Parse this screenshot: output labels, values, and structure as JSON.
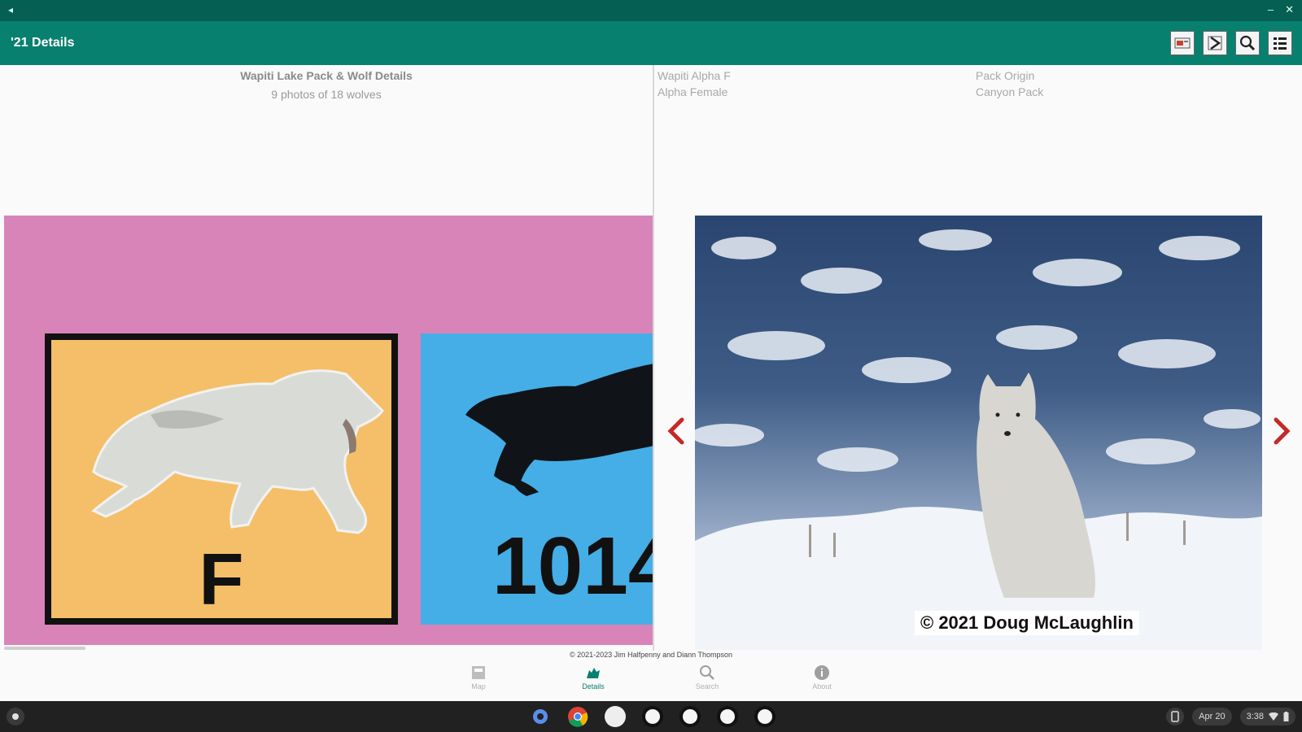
{
  "window": {
    "left_glyph": "◂",
    "min_glyph": "–",
    "close_glyph": "✕"
  },
  "appbar": {
    "title": "'21 Details",
    "actions": [
      {
        "icon": "map-view-icon"
      },
      {
        "icon": "expand-icon"
      },
      {
        "icon": "zoom-icon"
      },
      {
        "icon": "list-icon"
      }
    ]
  },
  "pack": {
    "title": "Wapiti Lake Pack & Wolf Details",
    "subtitle": "9 photos of 18 wolves",
    "card_letter": "F",
    "card_number": "1014"
  },
  "wolf": {
    "name": "Wapiti Alpha F",
    "role": "Alpha Female",
    "origin_label": "Pack Origin",
    "origin_value": "Canyon Pack",
    "photo_credit": "© 2021 Doug McLaughlin"
  },
  "footer": {
    "copyright": "© 2021-2023 Jim Halfpenny and Diann Thompson"
  },
  "nav": [
    {
      "label": "Map",
      "icon": "map-icon"
    },
    {
      "label": "Details",
      "icon": "wolf-icon"
    },
    {
      "label": "Search",
      "icon": "search-icon"
    },
    {
      "label": "About",
      "icon": "info-icon"
    }
  ],
  "shelf": {
    "date": "Apr 20",
    "time": "3:38"
  },
  "colors": {
    "accent": "#08806f",
    "pink_panel": "#d884b9",
    "card_orange": "#f4bf68",
    "card_blue": "#45aee6",
    "chevron": "#c62828"
  }
}
